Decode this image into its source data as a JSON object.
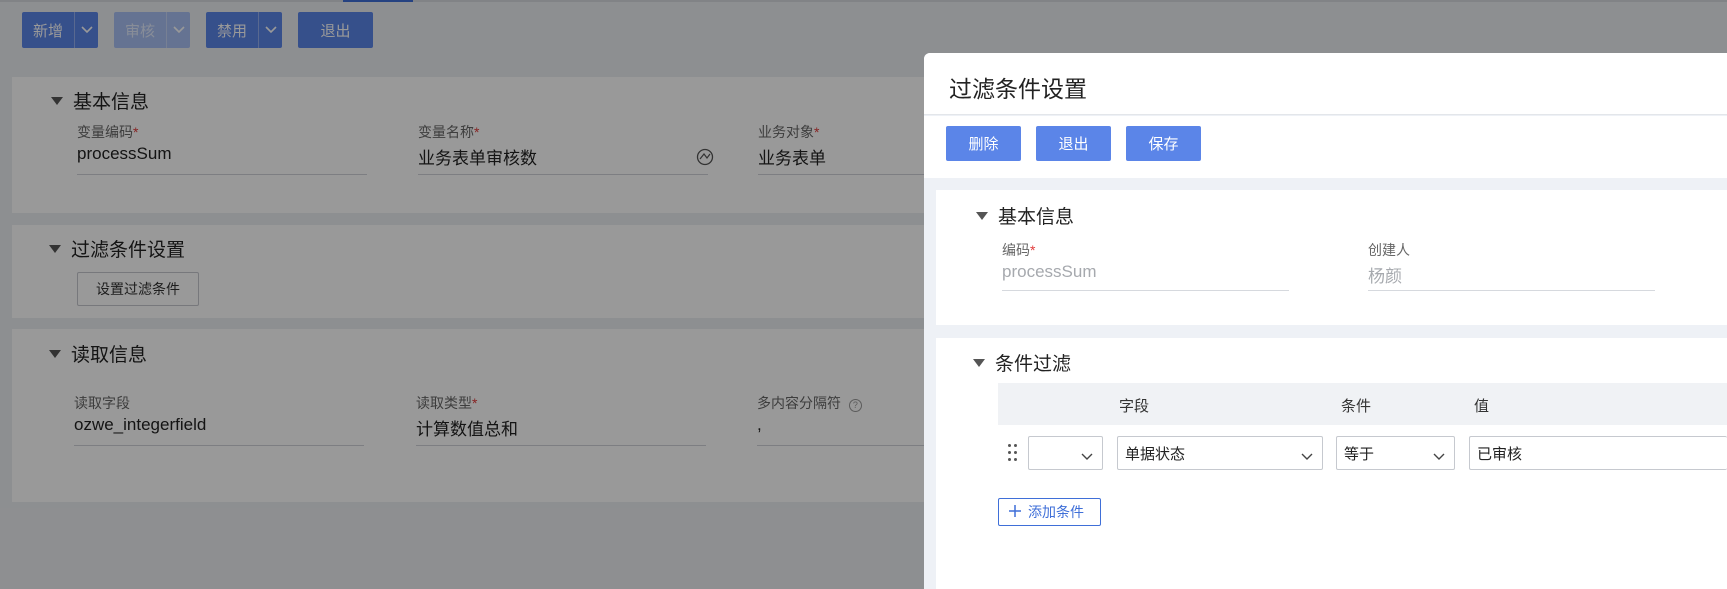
{
  "toolbar": {
    "add_label": "新增",
    "audit_label": "审核",
    "disable_label": "禁用",
    "exit_label": "退出"
  },
  "basic": {
    "title": "基本信息",
    "code_label": "变量编码",
    "code_value": "processSum",
    "name_label": "变量名称",
    "name_value": "业务表单审核数",
    "object_label": "业务对象",
    "object_value": "业务表单"
  },
  "filter": {
    "title": "过滤条件设置",
    "button_label": "设置过滤条件"
  },
  "read": {
    "title": "读取信息",
    "field_label": "读取字段",
    "field_value": "ozwe_integerfield",
    "type_label": "读取类型",
    "type_value": "计算数值总和",
    "sep_label": "多内容分隔符",
    "sep_value": ","
  },
  "drawer": {
    "title": "过滤条件设置",
    "delete_label": "删除",
    "exit_label": "退出",
    "save_label": "保存",
    "basic": {
      "title": "基本信息",
      "code_label": "编码",
      "code_value": "processSum",
      "creator_label": "创建人",
      "creator_value": "杨颜"
    },
    "condition": {
      "title": "条件过滤",
      "columns": {
        "field": "字段",
        "op": "条件",
        "value": "值"
      },
      "row": {
        "prefix": "",
        "field": "单据状态",
        "op": "等于",
        "value": "已审核"
      },
      "add_label": "添加条件"
    }
  }
}
